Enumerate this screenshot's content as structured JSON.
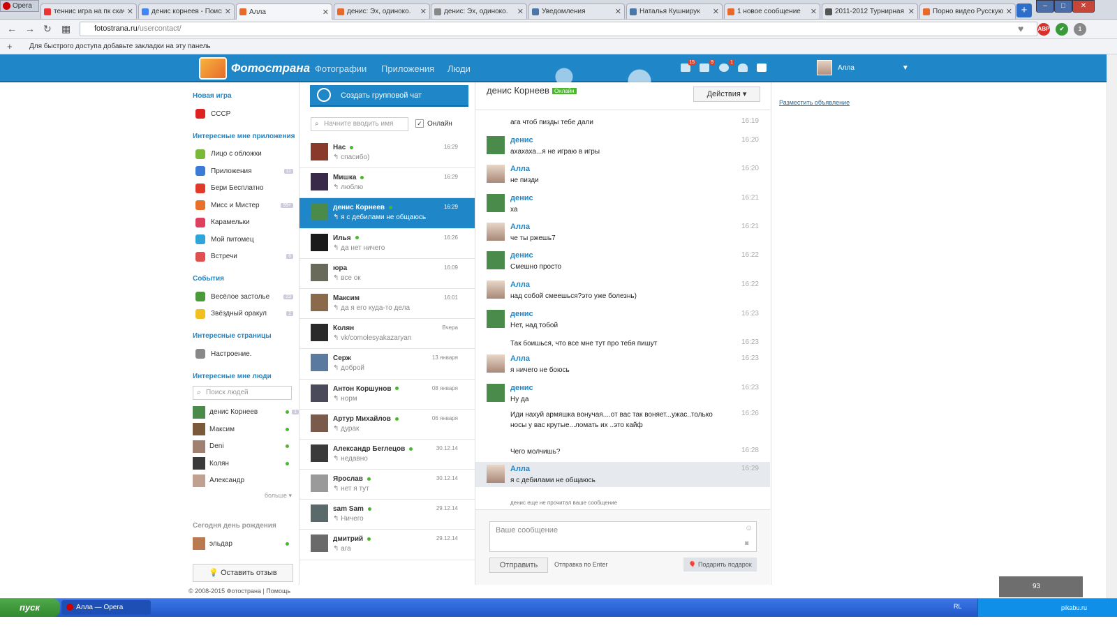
{
  "browser": {
    "menu_label": "Opera",
    "tabs": [
      {
        "title": "теннис игра на пк скач",
        "color": "#e33"
      },
      {
        "title": "денис корнеев - Поиск",
        "color": "#4285f4"
      },
      {
        "title": "Алла",
        "color": "#e86a2b"
      },
      {
        "title": "денис: Эх, одиноко.",
        "color": "#e86a2b"
      },
      {
        "title": "денис: Эх, одиноко.",
        "color": "#888"
      },
      {
        "title": "Уведомления",
        "color": "#4a76a8"
      },
      {
        "title": "Наталья Кушнирук",
        "color": "#4a76a8"
      },
      {
        "title": "1 новое сообщение",
        "color": "#e86a2b"
      },
      {
        "title": "2011-2012 Турнирная т",
        "color": "#555"
      },
      {
        "title": "Порно видео Русскую",
        "color": "#e86a2b"
      }
    ],
    "url_host": "fotostrana.ru",
    "url_path": "/usercontact/",
    "bookmarks_hint": "Для быстрого доступа добавьте закладки на эту панель",
    "extensions": [
      "ABP",
      "✔",
      "1"
    ]
  },
  "header": {
    "logo": "Фотострана",
    "nav": [
      "Фотографии",
      "Приложения",
      "Люди"
    ],
    "icon_badges": [
      "15",
      "9",
      "1"
    ],
    "user_name": "Алла"
  },
  "sidebar": {
    "new_game_heading": "Новая игра",
    "new_game": "СССР",
    "apps_heading": "Интересные мне приложения",
    "apps": [
      {
        "label": "Лицо с обложки",
        "count": "",
        "color": "#7ab83a"
      },
      {
        "label": "Приложения",
        "count": "11",
        "color": "#3a7bd5"
      },
      {
        "label": "Бери Бесплатно",
        "count": "",
        "color": "#e03a2a"
      },
      {
        "label": "Мисс и Мистер",
        "count": "99+",
        "color": "#e8702a"
      },
      {
        "label": "Карамельки",
        "count": "",
        "color": "#e04060"
      },
      {
        "label": "Мой питомец",
        "count": "",
        "color": "#2ea4d8"
      },
      {
        "label": "Встречи",
        "count": "6",
        "color": "#e05050"
      }
    ],
    "events_heading": "События",
    "events": [
      {
        "label": "Весёлое застолье",
        "count": "23",
        "color": "#4a9a3a"
      },
      {
        "label": "Звёздный оракул",
        "count": "2",
        "color": "#f0c020"
      }
    ],
    "pages_heading": "Интересные страницы",
    "pages": [
      {
        "label": "Настроение.",
        "color": "#888"
      }
    ],
    "people_heading": "Интересные мне люди",
    "people_search_placeholder": "Поиск людей",
    "people": [
      {
        "name": "денис Корнеев",
        "count": "1"
      },
      {
        "name": "Максим",
        "count": ""
      },
      {
        "name": "Deni",
        "count": ""
      },
      {
        "name": "Колян",
        "count": ""
      },
      {
        "name": "Александр",
        "count": ""
      }
    ],
    "more_label": "больше",
    "birthday_heading": "Сегодня день рождения",
    "birthday_person": "эльдар",
    "feedback_label": "Оставить отзыв",
    "copyright": "© 2008-2015 Фотострана | Помощь"
  },
  "chat_list": {
    "group_chat_label": "Создать групповой чат",
    "search_placeholder": "Начните вводить имя",
    "online_label": "Онлайн",
    "contacts": [
      {
        "name": "Нас",
        "time": "16:29",
        "message": "спасибо)",
        "online": true
      },
      {
        "name": "Мишка",
        "time": "16:29",
        "message": "люблю",
        "online": true
      },
      {
        "name": "денис Корнеев",
        "time": "16:29",
        "message": "я с дебилами не общаюсь",
        "online": true
      },
      {
        "name": "Илья",
        "time": "16:26",
        "message": "да нет ничего",
        "online": true
      },
      {
        "name": "юра",
        "time": "16:09",
        "message": "все ок",
        "online": false
      },
      {
        "name": "Максим",
        "time": "16:01",
        "message": "да я его куда-то дела",
        "online": false
      },
      {
        "name": "Колян",
        "time": "Вчера",
        "message": "vk/comolesyakazaryan",
        "online": false
      },
      {
        "name": "Серж",
        "time": "13 января",
        "message": "доброй",
        "online": false
      },
      {
        "name": "Антон Коршунов",
        "time": "08 января",
        "message": "норм",
        "online": true
      },
      {
        "name": "Артур Михайлов",
        "time": "06 января",
        "message": "дурак",
        "online": true
      },
      {
        "name": "Александр Беглецов",
        "time": "30.12.14",
        "message": "недавно",
        "online": true
      },
      {
        "name": "Ярослав",
        "time": "30.12.14",
        "message": "нет я тут",
        "online": true
      },
      {
        "name": "sam Sam",
        "time": "29.12.14",
        "message": "Ничего",
        "online": true
      },
      {
        "name": "дмитрий",
        "time": "29.12.14",
        "message": "ага",
        "online": true
      }
    ]
  },
  "chat": {
    "title": "денис Корнеев",
    "online_tag": "Онлайн",
    "actions_label": "Действия",
    "messages": [
      {
        "author": "",
        "text": "ага чтоб пизды тебе дали",
        "time": "16:19",
        "who": ""
      },
      {
        "author": "денис",
        "text": "ахахаха...я не играю в игры",
        "time": "16:20",
        "who": "d"
      },
      {
        "author": "Алла",
        "text": "не пизди",
        "time": "16:20",
        "who": "a"
      },
      {
        "author": "денис",
        "text": "ха",
        "time": "16:21",
        "who": "d"
      },
      {
        "author": "Алла",
        "text": "че ты ржешь7",
        "time": "16:21",
        "who": "a"
      },
      {
        "author": "денис",
        "text": "Смешно просто",
        "time": "16:22",
        "who": "d"
      },
      {
        "author": "Алла",
        "text": "над собой смеешься?это уже болезнь)",
        "time": "16:22",
        "who": "a"
      },
      {
        "author": "денис",
        "text": "Нет, над тобой",
        "time": "16:23",
        "who": "d"
      },
      {
        "author": "",
        "text": "Так боишься, что все мне тут про тебя пишут",
        "time": "16:23",
        "who": ""
      },
      {
        "author": "Алла",
        "text": "я ничего не боюсь",
        "time": "16:23",
        "who": "a"
      },
      {
        "author": "денис",
        "text": "Ну да",
        "time": "16:23",
        "who": "d"
      },
      {
        "author": "",
        "text": "Иди нахуй армяшка вонучая....от вас так воняет...ужас..только носы у вас крутые...ломать их ..это кайф",
        "time": "16:26",
        "who": ""
      },
      {
        "author": "",
        "text": "Чего молчишь?",
        "time": "16:28",
        "who": ""
      },
      {
        "author": "Алла",
        "text": "я с дебилами не общаюсь",
        "time": "16:29",
        "who": "a"
      }
    ],
    "read_status": "денис еще не прочитал ваше сообщение",
    "input_placeholder": "Ваше сообщение",
    "send_label": "Отправить",
    "enter_note": "Отправка по Enter",
    "gift_label": "Подарить подарок"
  },
  "ad_link": "Разместить объявление",
  "widget_count": "93",
  "taskbar": {
    "start_label": "пуск",
    "task_label": "Алла — Opera",
    "lang": "RL",
    "watermark": "pikabu.ru"
  }
}
